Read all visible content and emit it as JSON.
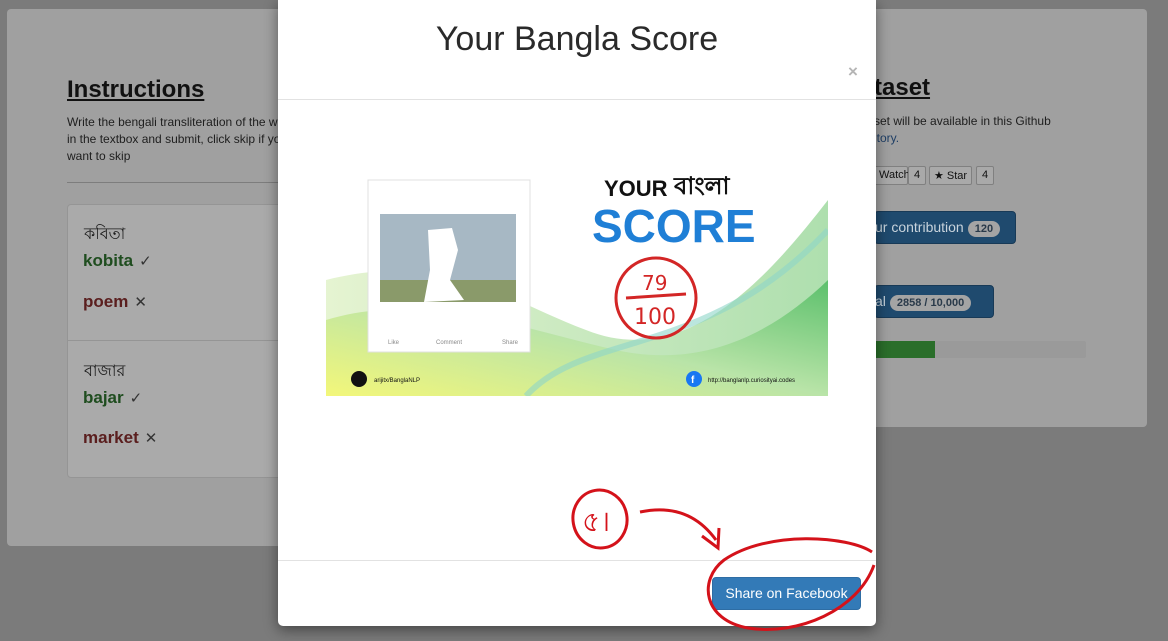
{
  "background": {
    "instructions": {
      "title": "Instructions",
      "text": "Write the bengali transliteration of the word in the textbox and submit, click skip if you want to skip"
    },
    "words": [
      {
        "bengali": "কবিতা",
        "answers": [
          {
            "text": "kobita",
            "mark": "✓"
          },
          {
            "text": "poem",
            "mark": "✕"
          }
        ]
      },
      {
        "bengali": "বাজার",
        "answers": [
          {
            "text": "bajar",
            "mark": "✓"
          },
          {
            "text": "market",
            "mark": "✕"
          }
        ]
      }
    ],
    "dataset": {
      "title_visible": "taset",
      "text_line1": "set will be available in this Github",
      "text_link": "itory.",
      "watch_label": "Watch",
      "watch_count": "4",
      "star_label": "★ Star",
      "star_count": "4",
      "contribution_label": "ur contribution",
      "contribution_count": "120",
      "goal_label": "al",
      "goal_count": "2858 / 10,000",
      "progress_fraction": 0.2858
    }
  },
  "modal": {
    "title": "Your Bangla Score",
    "close_symbol": "×",
    "share_button": "Share on Facebook",
    "score_card": {
      "heading_en": "YOUR",
      "heading_bn": "বাংলা",
      "heading_score": "SCORE",
      "score_value": "79",
      "score_total": "100",
      "post_actions": [
        "Like",
        "Comment",
        "Share"
      ],
      "github_handle": "arijitx/BanglaNLP",
      "site_url": "http://banglanlp.curiosityai.codes"
    },
    "annotation": "৫।"
  },
  "colors": {
    "score_blue": "#1f7fd6",
    "score_red": "#d32626",
    "fb_button": "#337ab7",
    "annotation_red": "#d4121a"
  }
}
